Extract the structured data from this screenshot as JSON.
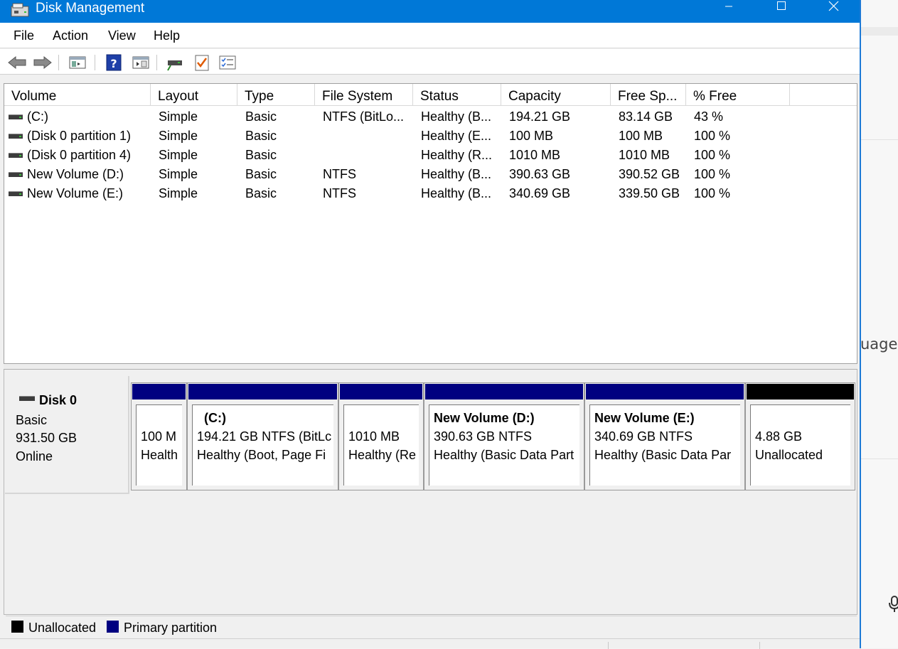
{
  "window": {
    "title": "Disk Management",
    "minimize_icon": "minimize-icon",
    "maximize_icon": "maximize-icon",
    "close_icon": "close-icon"
  },
  "menu": [
    "File",
    "Action",
    "View",
    "Help"
  ],
  "toolbar": {
    "buttons": [
      "back-arrow-icon",
      "forward-arrow-icon",
      "console-tree-icon",
      "help-icon",
      "properties-icon",
      "connect-disk-icon",
      "checklist-icon",
      "details-list-icon"
    ]
  },
  "volume_list": {
    "columns": [
      "Volume",
      "Layout",
      "Type",
      "File System",
      "Status",
      "Capacity",
      "Free Sp...",
      "% Free"
    ],
    "rows": [
      {
        "volume": " (C:)",
        "layout": "Simple",
        "type": "Basic",
        "fs": "NTFS (BitLo...",
        "status": "Healthy (B...",
        "capacity": "194.21 GB",
        "free": "83.14 GB",
        "pct": "43 %"
      },
      {
        "volume": "(Disk 0 partition 1)",
        "layout": "Simple",
        "type": "Basic",
        "fs": "",
        "status": "Healthy (E...",
        "capacity": "100 MB",
        "free": "100 MB",
        "pct": "100 %"
      },
      {
        "volume": "(Disk 0 partition 4)",
        "layout": "Simple",
        "type": "Basic",
        "fs": "",
        "status": "Healthy (R...",
        "capacity": "1010 MB",
        "free": "1010 MB",
        "pct": "100 %"
      },
      {
        "volume": "New Volume (D:)",
        "layout": "Simple",
        "type": "Basic",
        "fs": "NTFS",
        "status": "Healthy (B...",
        "capacity": "390.63 GB",
        "free": "390.52 GB",
        "pct": "100 %"
      },
      {
        "volume": "New Volume (E:)",
        "layout": "Simple",
        "type": "Basic",
        "fs": "NTFS",
        "status": "Healthy (B...",
        "capacity": "340.69 GB",
        "free": "339.50 GB",
        "pct": "100 %"
      }
    ]
  },
  "disk": {
    "name": "Disk 0",
    "type": "Basic",
    "size": "931.50 GB",
    "state": "Online",
    "partitions": [
      {
        "title": "",
        "line1": "100 M",
        "line2": "Health",
        "kind": "primary"
      },
      {
        "title": "(C:)",
        "line1": "194.21 GB NTFS (BitLc",
        "line2": "Healthy (Boot, Page Fi",
        "kind": "primary"
      },
      {
        "title": "",
        "line1": "1010 MB",
        "line2": "Healthy (Re",
        "kind": "primary"
      },
      {
        "title": "New Volume  (D:)",
        "line1": "390.63 GB NTFS",
        "line2": "Healthy (Basic Data Part",
        "kind": "primary"
      },
      {
        "title": "New Volume  (E:)",
        "line1": "340.69 GB NTFS",
        "line2": "Healthy (Basic Data Par",
        "kind": "primary"
      },
      {
        "title": "",
        "line1": "4.88 GB",
        "line2": "Unallocated",
        "kind": "unallocated"
      }
    ]
  },
  "legend": {
    "unallocated_label": "Unallocated",
    "primary_label": "Primary partition",
    "unallocated_color": "#000000",
    "primary_color": "#000080"
  },
  "background_app": {
    "partial_text": "uage",
    "mic_icon": "microphone-icon"
  }
}
